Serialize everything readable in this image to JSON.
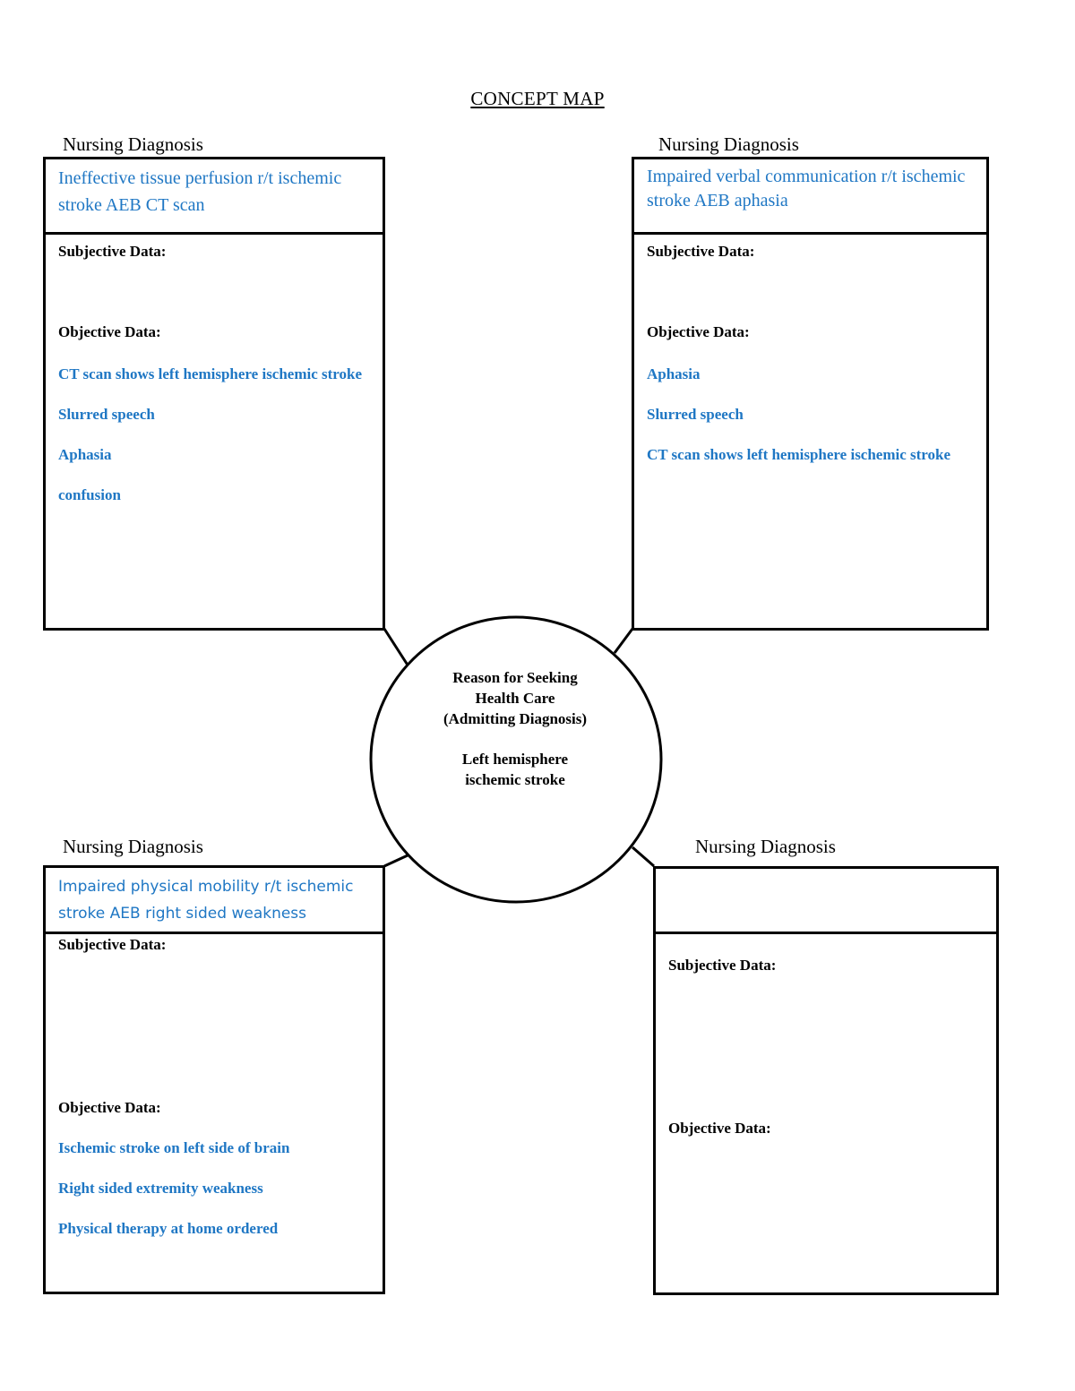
{
  "title": "CONCEPT MAP",
  "center": {
    "heading_lines": [
      "Reason for Seeking",
      "Health Care",
      "(Admitting Diagnosis)"
    ],
    "diagnosis_lines": [
      "Left hemisphere",
      "ischemic stroke"
    ]
  },
  "colors": {
    "entry_text": "#1f77c4",
    "border": "#000000"
  },
  "boxes": [
    {
      "label": "Nursing Diagnosis",
      "diagnosis": "Ineffective tissue perfusion r/t ischemic stroke AEB CT scan",
      "subjective_label": "Subjective Data:",
      "subjective": [],
      "objective_label": "Objective Data:",
      "objective": [
        "CT scan shows left hemisphere ischemic stroke",
        "Slurred speech",
        "Aphasia",
        "confusion"
      ]
    },
    {
      "label": "Nursing Diagnosis",
      "diagnosis": "Impaired verbal communication r/t ischemic stroke AEB aphasia",
      "subjective_label": "Subjective Data:",
      "subjective": [],
      "objective_label": "Objective Data:",
      "objective": [
        "Aphasia",
        "Slurred speech",
        "CT scan shows left hemisphere ischemic stroke"
      ]
    },
    {
      "label": "Nursing Diagnosis",
      "diagnosis": "Impaired physical mobility r/t ischemic stroke AEB right sided weakness",
      "subjective_label": "Subjective Data:",
      "subjective": [],
      "objective_label": "Objective Data:",
      "objective": [
        "Ischemic stroke on left side of brain",
        "Right sided extremity weakness",
        "Physical therapy at home ordered"
      ]
    },
    {
      "label": "Nursing Diagnosis",
      "diagnosis": "",
      "subjective_label": "Subjective Data:",
      "subjective": [],
      "objective_label": "Objective Data:",
      "objective": []
    }
  ]
}
